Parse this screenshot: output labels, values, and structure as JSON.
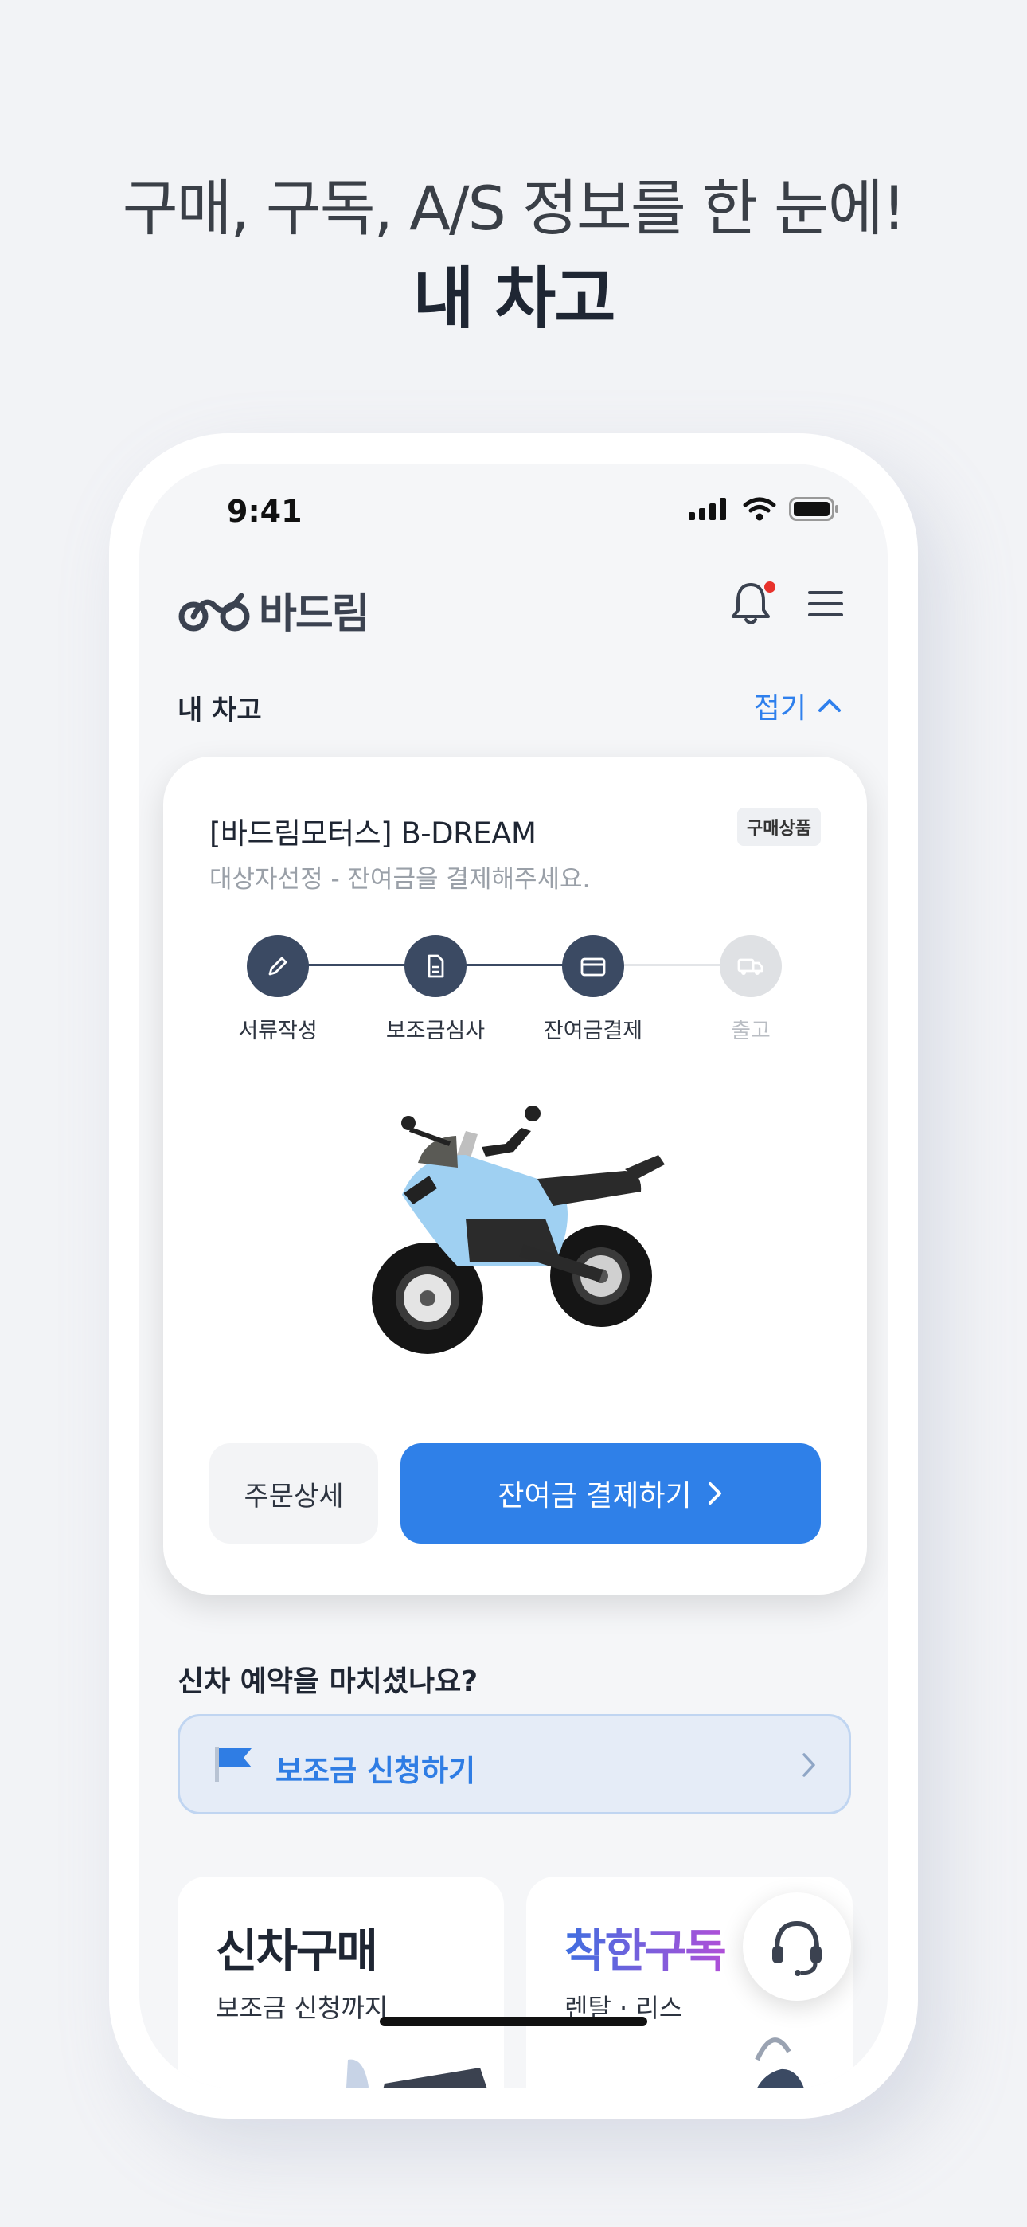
{
  "promo": {
    "headline": "구매, 구독, A/S 정보를 한 눈에!",
    "title": "내 차고"
  },
  "status_bar": {
    "time": "9:41",
    "icons": [
      "signal-icon",
      "wifi-icon",
      "battery-icon"
    ]
  },
  "header": {
    "logo_text": "바드림",
    "notification_dot": true,
    "accent_color": "#2f80ed"
  },
  "garage": {
    "section_title": "내 차고",
    "collapse_label": "접기"
  },
  "order_card": {
    "title": "[바드림모터스] B-DREAM",
    "badge": "구매상품",
    "subtitle": "대상자선정 - 잔여금을 결제해주세요.",
    "steps": [
      {
        "label": "서류작성",
        "icon": "pencil-icon",
        "state": "done"
      },
      {
        "label": "보조금심사",
        "icon": "document-icon",
        "state": "done"
      },
      {
        "label": "잔여금결제",
        "icon": "credit-card-icon",
        "state": "current"
      },
      {
        "label": "출고",
        "icon": "truck-icon",
        "state": "pending"
      }
    ],
    "detail_button": "주문상세",
    "pay_button": "잔여금 결제하기"
  },
  "reservation": {
    "question": "신차 예약을 마치셨나요?",
    "subsidy_label": "보조금 신청하기"
  },
  "tiles": [
    {
      "title": "신차구매",
      "subtitle": "보조금 신청까지",
      "color": "#1f2633"
    },
    {
      "title": "착한구독",
      "subtitle": "렌탈 · 리스",
      "color_from": "#3f6fe0",
      "color_to": "#b04fd8"
    }
  ]
}
